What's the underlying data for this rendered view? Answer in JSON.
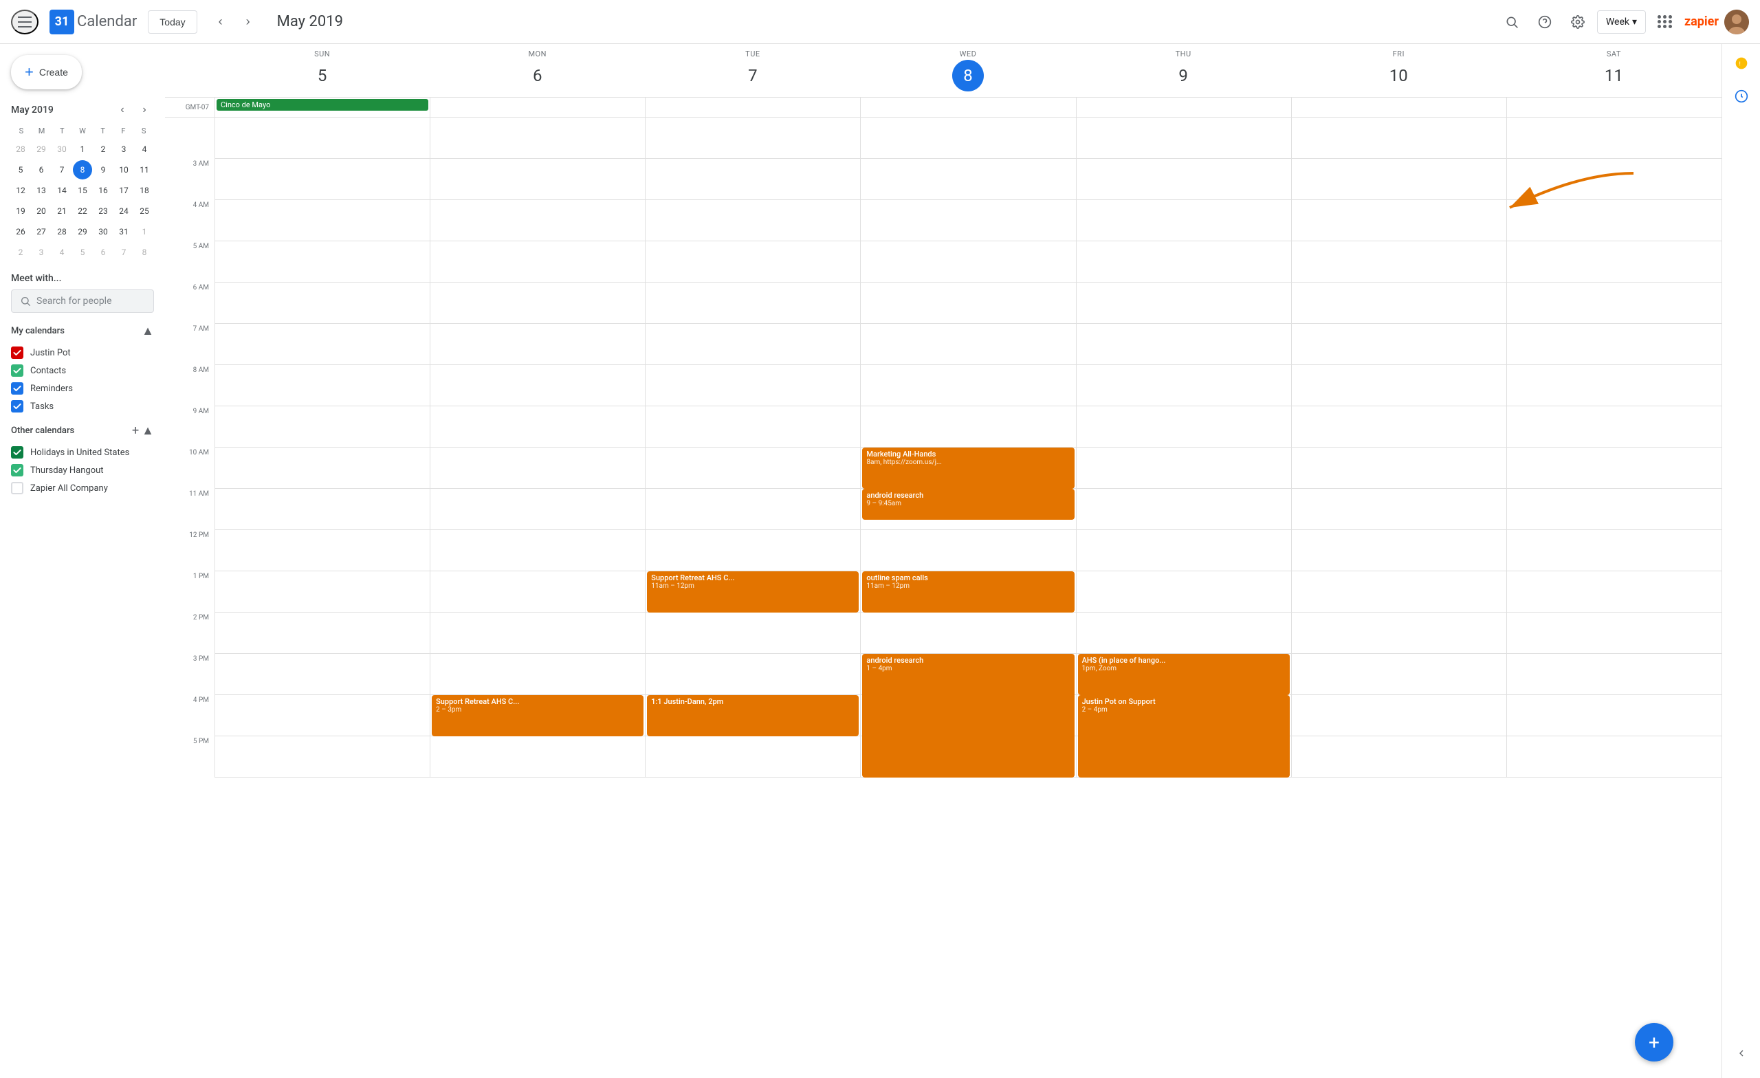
{
  "header": {
    "today_label": "Today",
    "current_period": "May 2019",
    "view_label": "Week",
    "search_tooltip": "Search",
    "help_tooltip": "Help",
    "settings_tooltip": "Settings",
    "zapier_label": "zapier"
  },
  "sidebar": {
    "create_label": "Create",
    "mini_calendar": {
      "title": "May 2019",
      "days_of_week": [
        "S",
        "M",
        "T",
        "W",
        "T",
        "F",
        "S"
      ],
      "weeks": [
        [
          {
            "d": 28,
            "om": true
          },
          {
            "d": 29,
            "om": true
          },
          {
            "d": 30,
            "om": true
          },
          {
            "d": 1
          },
          {
            "d": 2
          },
          {
            "d": 3
          },
          {
            "d": 4
          }
        ],
        [
          {
            "d": 5
          },
          {
            "d": 6
          },
          {
            "d": 7
          },
          {
            "d": 8,
            "today": true
          },
          {
            "d": 9
          },
          {
            "d": 10
          },
          {
            "d": 11
          }
        ],
        [
          {
            "d": 12
          },
          {
            "d": 13
          },
          {
            "d": 14
          },
          {
            "d": 15
          },
          {
            "d": 16
          },
          {
            "d": 17
          },
          {
            "d": 18
          }
        ],
        [
          {
            "d": 19
          },
          {
            "d": 20
          },
          {
            "d": 21
          },
          {
            "d": 22
          },
          {
            "d": 23
          },
          {
            "d": 24
          },
          {
            "d": 25
          }
        ],
        [
          {
            "d": 26
          },
          {
            "d": 27
          },
          {
            "d": 28
          },
          {
            "d": 29
          },
          {
            "d": 30
          },
          {
            "d": 31
          },
          {
            "d": 1,
            "om": true
          }
        ],
        [
          {
            "d": 2,
            "om": true
          },
          {
            "d": 3,
            "om": true
          },
          {
            "d": 4,
            "om": true
          },
          {
            "d": 5,
            "om": true
          },
          {
            "d": 6,
            "om": true
          },
          {
            "d": 7,
            "om": true
          },
          {
            "d": 8,
            "om": true
          }
        ]
      ]
    },
    "meet_title": "Meet with...",
    "people_search_placeholder": "Search for people",
    "my_calendars_title": "My calendars",
    "my_calendars": [
      {
        "name": "Justin Pot",
        "color": "#d50000",
        "checked": true
      },
      {
        "name": "Contacts",
        "color": "#33b679",
        "checked": true
      },
      {
        "name": "Reminders",
        "color": "#1a73e8",
        "checked": true
      },
      {
        "name": "Tasks",
        "color": "#1a73e8",
        "checked": true
      }
    ],
    "other_calendars_title": "Other calendars",
    "other_calendars": [
      {
        "name": "Holidays in United States",
        "color": "#0b8043",
        "checked": true
      },
      {
        "name": "Thursday Hangout",
        "color": "#33b679",
        "checked": true
      },
      {
        "name": "Zapier All Company",
        "color": "#ffffff",
        "checked": false,
        "border": "#dadce0"
      }
    ]
  },
  "calendar_grid": {
    "timezone": "GMT-07",
    "days": [
      {
        "dow": "SUN",
        "dom": 5,
        "col": 0
      },
      {
        "dow": "MON",
        "dom": 6,
        "col": 1
      },
      {
        "dow": "TUE",
        "dom": 7,
        "col": 2
      },
      {
        "dow": "WED",
        "dom": 8,
        "col": 3,
        "today": true
      },
      {
        "dow": "THU",
        "dom": 9,
        "col": 4
      },
      {
        "dow": "FRI",
        "dom": 10,
        "col": 5
      },
      {
        "dow": "SAT",
        "dom": 11,
        "col": 6
      }
    ],
    "allday_events": [
      {
        "col": 0,
        "title": "Cinco de Mayo",
        "color": "#1e8e3e"
      }
    ],
    "time_labels": [
      "",
      "3 AM",
      "4 AM",
      "5 AM",
      "6 AM",
      "7 AM",
      "8 AM",
      "9 AM",
      "10 AM",
      "11 AM",
      "12 PM",
      "1 PM",
      "2 PM",
      "3 PM",
      "4 PM",
      "5 PM"
    ],
    "events": [
      {
        "col": 3,
        "title": "Marketing All-Hands",
        "subtitle": "8am, https://zoom.us/j...",
        "top_hour": 8,
        "top_min": 0,
        "duration_min": 60,
        "color": "#e37400"
      },
      {
        "col": 3,
        "title": "android research",
        "subtitle": "9 – 9:45am",
        "top_hour": 9,
        "top_min": 0,
        "duration_min": 45,
        "color": "#e37400"
      },
      {
        "col": 2,
        "title": "Support Retreat AHS C...",
        "subtitle": "11am – 12pm",
        "top_hour": 11,
        "top_min": 0,
        "duration_min": 60,
        "color": "#e37400"
      },
      {
        "col": 3,
        "title": "outline spam calls",
        "subtitle": "11am – 12pm",
        "top_hour": 11,
        "top_min": 0,
        "duration_min": 60,
        "color": "#e37400"
      },
      {
        "col": 3,
        "title": "android research",
        "subtitle": "1 – 4pm",
        "top_hour": 13,
        "top_min": 0,
        "duration_min": 180,
        "color": "#e37400"
      },
      {
        "col": 4,
        "title": "AHS (in place of hango...",
        "subtitle": "1pm, Zoom",
        "top_hour": 13,
        "top_min": 0,
        "duration_min": 60,
        "color": "#e37400"
      },
      {
        "col": 4,
        "title": "Justin Pot on Support",
        "subtitle": "2 – 4pm",
        "top_hour": 14,
        "top_min": 0,
        "duration_min": 120,
        "color": "#e37400"
      },
      {
        "col": 1,
        "title": "Support Retreat AHS C...",
        "subtitle": "2 – 3pm",
        "top_hour": 14,
        "top_min": 0,
        "duration_min": 60,
        "color": "#e37400"
      },
      {
        "col": 2,
        "title": "1:1 Justin-Dann, 2pm",
        "subtitle": "",
        "top_hour": 14,
        "top_min": 0,
        "duration_min": 60,
        "color": "#e37400"
      }
    ]
  }
}
